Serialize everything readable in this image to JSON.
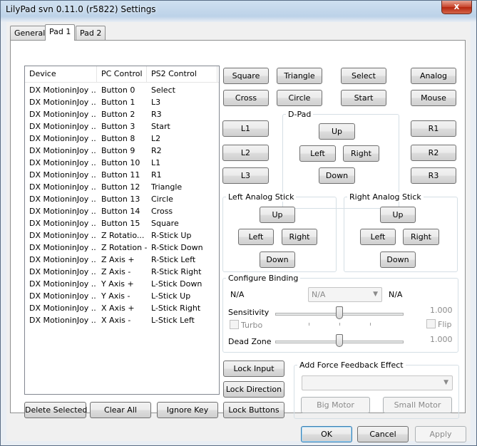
{
  "window": {
    "title": "LilyPad svn 0.11.0 (r5822) Settings",
    "close_glyph": "x"
  },
  "tabs": [
    {
      "label": "General"
    },
    {
      "label": "Pad 1"
    },
    {
      "label": "Pad 2"
    }
  ],
  "binding_list": {
    "headers": {
      "device": "Device",
      "pc_control": "PC Control",
      "ps2_control": "PS2 Control"
    },
    "rows": [
      {
        "device": "DX MotioninJoy ...",
        "pc": "Button 0",
        "ps2": "Select"
      },
      {
        "device": "DX MotioninJoy ...",
        "pc": "Button 1",
        "ps2": "L3"
      },
      {
        "device": "DX MotioninJoy ...",
        "pc": "Button 2",
        "ps2": "R3"
      },
      {
        "device": "DX MotioninJoy ...",
        "pc": "Button 3",
        "ps2": "Start"
      },
      {
        "device": "DX MotioninJoy ...",
        "pc": "Button 8",
        "ps2": "L2"
      },
      {
        "device": "DX MotioninJoy ...",
        "pc": "Button 9",
        "ps2": "R2"
      },
      {
        "device": "DX MotioninJoy ...",
        "pc": "Button 10",
        "ps2": "L1"
      },
      {
        "device": "DX MotioninJoy ...",
        "pc": "Button 11",
        "ps2": "R1"
      },
      {
        "device": "DX MotioninJoy ...",
        "pc": "Button 12",
        "ps2": "Triangle"
      },
      {
        "device": "DX MotioninJoy ...",
        "pc": "Button 13",
        "ps2": "Circle"
      },
      {
        "device": "DX MotioninJoy ...",
        "pc": "Button 14",
        "ps2": "Cross"
      },
      {
        "device": "DX MotioninJoy ...",
        "pc": "Button 15",
        "ps2": "Square"
      },
      {
        "device": "DX MotioninJoy ...",
        "pc": "Z Rotatio...",
        "ps2": "R-Stick Up"
      },
      {
        "device": "DX MotioninJoy ...",
        "pc": "Z Rotation -",
        "ps2": "R-Stick Down"
      },
      {
        "device": "DX MotioninJoy ...",
        "pc": "Z Axis +",
        "ps2": "R-Stick Left"
      },
      {
        "device": "DX MotioninJoy ...",
        "pc": "Z Axis -",
        "ps2": "R-Stick Right"
      },
      {
        "device": "DX MotioninJoy ...",
        "pc": "Y Axis +",
        "ps2": "L-Stick Down"
      },
      {
        "device": "DX MotioninJoy ...",
        "pc": "Y Axis -",
        "ps2": "L-Stick Up"
      },
      {
        "device": "DX MotioninJoy ...",
        "pc": "X Axis +",
        "ps2": "L-Stick Right"
      },
      {
        "device": "DX MotioninJoy ...",
        "pc": "X Axis -",
        "ps2": "L-Stick Left"
      }
    ]
  },
  "list_buttons": {
    "delete_selected": "Delete Selected",
    "clear_all": "Clear All",
    "ignore_key": "Ignore Key"
  },
  "face_buttons": {
    "square": "Square",
    "triangle": "Triangle",
    "select": "Select",
    "analog": "Analog",
    "cross": "Cross",
    "circle": "Circle",
    "start": "Start",
    "mouse": "Mouse",
    "l1": "L1",
    "l2": "L2",
    "l3": "L3",
    "r1": "R1",
    "r2": "R2",
    "r3": "R3"
  },
  "dpad": {
    "label": "D-Pad",
    "up": "Up",
    "left": "Left",
    "right": "Right",
    "down": "Down"
  },
  "left_stick": {
    "label": "Left Analog Stick",
    "up": "Up",
    "left": "Left",
    "right": "Right",
    "down": "Down"
  },
  "right_stick": {
    "label": "Right Analog Stick",
    "up": "Up",
    "left": "Left",
    "right": "Right",
    "down": "Down"
  },
  "configure_binding": {
    "label": "Configure Binding",
    "left_value": "N/A",
    "combo_value": "N/A",
    "right_value": "N/A",
    "sensitivity_label": "Sensitivity",
    "sensitivity_value": "1.000",
    "sensitivity_level": 0.5,
    "turbo_label": "Turbo",
    "flip_label": "Flip",
    "dead_zone_label": "Dead Zone",
    "dead_zone_value": "1.000",
    "dead_zone_level": 0.5
  },
  "lock_buttons": {
    "lock_input": "Lock Input",
    "lock_direction": "Lock Direction",
    "lock_buttons": "Lock Buttons"
  },
  "force_feedback": {
    "label": "Add Force Feedback Effect",
    "big_motor": "Big Motor",
    "small_motor": "Small Motor"
  },
  "dialog_buttons": {
    "ok": "OK",
    "cancel": "Cancel",
    "apply": "Apply"
  }
}
